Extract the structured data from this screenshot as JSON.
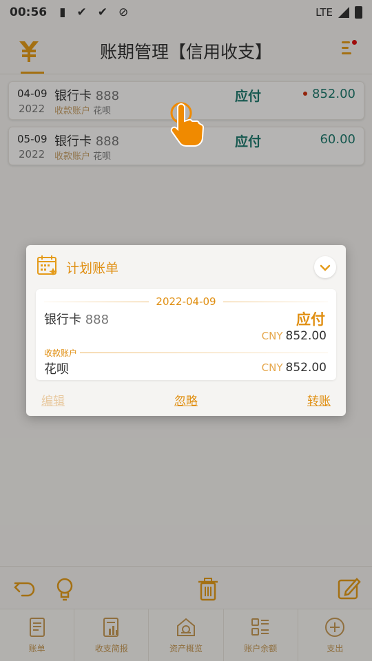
{
  "status_bar": {
    "time": "00:56",
    "network": "LTE"
  },
  "header": {
    "title": "账期管理【信用收支】"
  },
  "bills": [
    {
      "date": "04-09",
      "year": "2022",
      "account": "银行卡",
      "account_num": "888",
      "payee_label": "收款账户",
      "payee": "花呗",
      "type": "应付",
      "amount": "852.00",
      "unread": true
    },
    {
      "date": "05-09",
      "year": "2022",
      "account": "银行卡",
      "account_num": "888",
      "payee_label": "收款账户",
      "payee": "花呗",
      "type": "应付",
      "amount": "60.00",
      "unread": false
    }
  ],
  "dialog": {
    "title": "计划账单",
    "date": "2022-04-09",
    "account": "银行卡",
    "account_num": "888",
    "type": "应付",
    "currency": "CNY",
    "amount": "852.00",
    "payee_label": "收款账户",
    "payee": "花呗",
    "payee_currency": "CNY",
    "payee_amount": "852.00",
    "actions": {
      "edit": "编辑",
      "ignore": "忽略",
      "transfer": "转账"
    }
  },
  "tabs": [
    {
      "label": "账单",
      "icon": "bill-icon"
    },
    {
      "label": "收支简报",
      "icon": "report-icon"
    },
    {
      "label": "资产概览",
      "icon": "assets-icon"
    },
    {
      "label": "账户余额",
      "icon": "balance-icon"
    },
    {
      "label": "支出",
      "icon": "add-expense-icon"
    }
  ],
  "colors": {
    "accent": "#e49b1a",
    "teal": "#1f7a6e",
    "background": "#f4f2ef"
  }
}
